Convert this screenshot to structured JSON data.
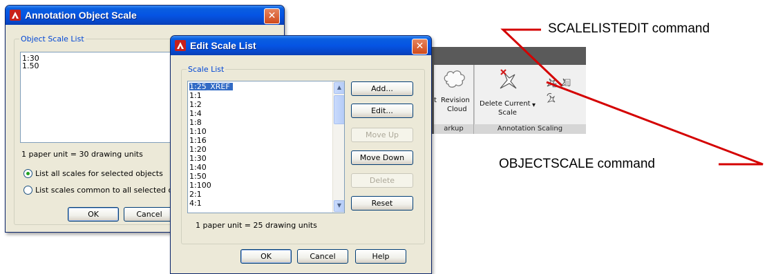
{
  "annotation_dialog": {
    "title": "Annotation Object Scale",
    "close_glyph": "✕",
    "group_label": "Object Scale List",
    "scales": [
      "1:30",
      "1.50"
    ],
    "unit_info": "1 paper unit = 30 drawing units",
    "radio_all": "List all scales for selected objects",
    "radio_common": "List scales common to all selected ol",
    "ok": "OK",
    "cancel": "Cancel"
  },
  "edit_dialog": {
    "title": "Edit Scale List",
    "close_glyph": "✕",
    "group_label": "Scale List",
    "scales": [
      "1:25_XREF",
      "1:1",
      "1:2",
      "1:4",
      "1:8",
      "1:10",
      "1:16",
      "1:20",
      "1:30",
      "1:40",
      "1:50",
      "1:100",
      "2:1",
      "4:1"
    ],
    "selected_scale": "1:25_XREF",
    "buttons": {
      "add": "Add...",
      "edit": "Edit...",
      "move_up": "Move Up",
      "move_down": "Move Down",
      "delete": "Delete",
      "reset": "Reset"
    },
    "unit_info": "1 paper unit = 25 drawing units",
    "ok": "OK",
    "cancel": "Cancel",
    "help": "Help"
  },
  "ribbon": {
    "revision_cloud_line1": "Revision",
    "revision_cloud_line2": "Cloud",
    "delete_scale_line1": "Delete Current",
    "delete_scale_line2": "Scale",
    "panel_markup_label": "arkup",
    "panel_annotation_scaling_label": "Annotation Scaling",
    "partial_label": "t"
  },
  "callouts": {
    "scalelistedit": "SCALELISTEDIT command",
    "objectscale": "OBJECTSCALE command"
  },
  "colors": {
    "title_bar": "#0554e3",
    "close_button": "#d04a1a",
    "callout_line": "#d40000",
    "groupbox_label": "#0046d5",
    "selection": "#316ac5"
  }
}
